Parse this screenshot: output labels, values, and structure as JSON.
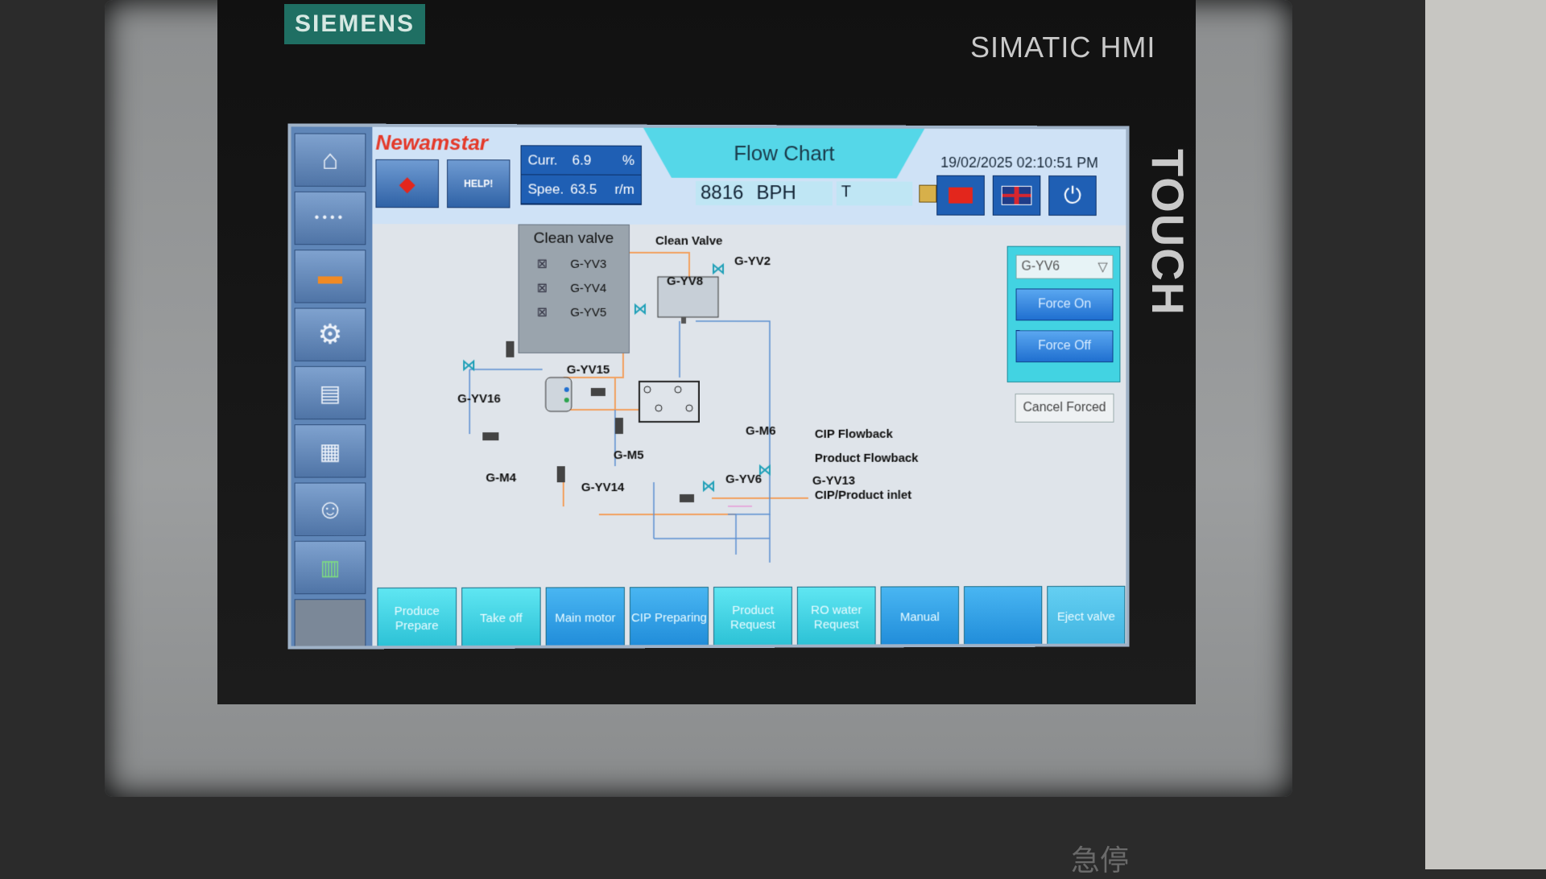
{
  "device": {
    "brand": "SIEMENS",
    "model": "SIMATIC HMI",
    "side_label": "TOUCH",
    "panel_text": "急停"
  },
  "header": {
    "logo": "Newamstar",
    "help_label": "HELP!",
    "current_label": "Curr.",
    "current_value": "6.9",
    "current_unit": "%",
    "speed_label": "Spee.",
    "speed_value": "63.5",
    "speed_unit": "r/m",
    "title": "Flow Chart",
    "bph_value": "8816",
    "bph_unit": "BPH",
    "t_field": "T",
    "datetime": "19/02/2025 02:10:51 PM"
  },
  "sidebar": {
    "items": [
      {
        "name": "home",
        "icon": "⌂"
      },
      {
        "name": "cip",
        "icon": "••••"
      },
      {
        "name": "servo",
        "icon": "▬"
      },
      {
        "name": "settings",
        "icon": "⚙"
      },
      {
        "name": "manual-book",
        "icon": "📖"
      },
      {
        "name": "machine",
        "icon": "▦"
      },
      {
        "name": "operator",
        "icon": "☺"
      },
      {
        "name": "io",
        "icon": "▤"
      },
      {
        "name": "blank",
        "icon": ""
      }
    ]
  },
  "clean_valve_panel": {
    "title": "Clean valve",
    "valves": [
      "G-YV3",
      "G-YV4",
      "G-YV5"
    ]
  },
  "diagram_labels": {
    "clean_valve": "Clean Valve",
    "yv2": "G-YV2",
    "yv8": "G-YV8",
    "yv15": "G-YV15",
    "yv16": "G-YV16",
    "m4": "G-M4",
    "m5": "G-M5",
    "m6": "G-M6",
    "yv14": "G-YV14",
    "yv6": "G-YV6",
    "yv13": "G-YV13",
    "cip_flowback": "CIP Flowback",
    "product_flowback": "Product Flowback",
    "cip_product_inlet": "CIP/Product inlet"
  },
  "force_panel": {
    "selected_valve": "G-YV6",
    "force_on": "Force On",
    "force_off": "Force Off",
    "cancel_forced": "Cancel Forced"
  },
  "bottom_buttons": [
    {
      "label": "Produce Prepare",
      "style": "cyan"
    },
    {
      "label": "Take off",
      "style": "cyan"
    },
    {
      "label": "Main motor",
      "style": "blue"
    },
    {
      "label": "CIP Preparing",
      "style": "blue"
    },
    {
      "label": "Product Request",
      "style": "cyan"
    },
    {
      "label": "RO water Request",
      "style": "cyan"
    },
    {
      "label": "Manual",
      "style": "blue"
    },
    {
      "label": "",
      "style": "blue"
    },
    {
      "label": "Eject valve",
      "style": "lt"
    }
  ],
  "colors": {
    "sidebar": "#5f86b8",
    "title_tab": "#55d7e8",
    "pipe_orange": "#f2a160",
    "pipe_blue": "#5b8fd0",
    "pipe_pink": "#e79ad6"
  }
}
